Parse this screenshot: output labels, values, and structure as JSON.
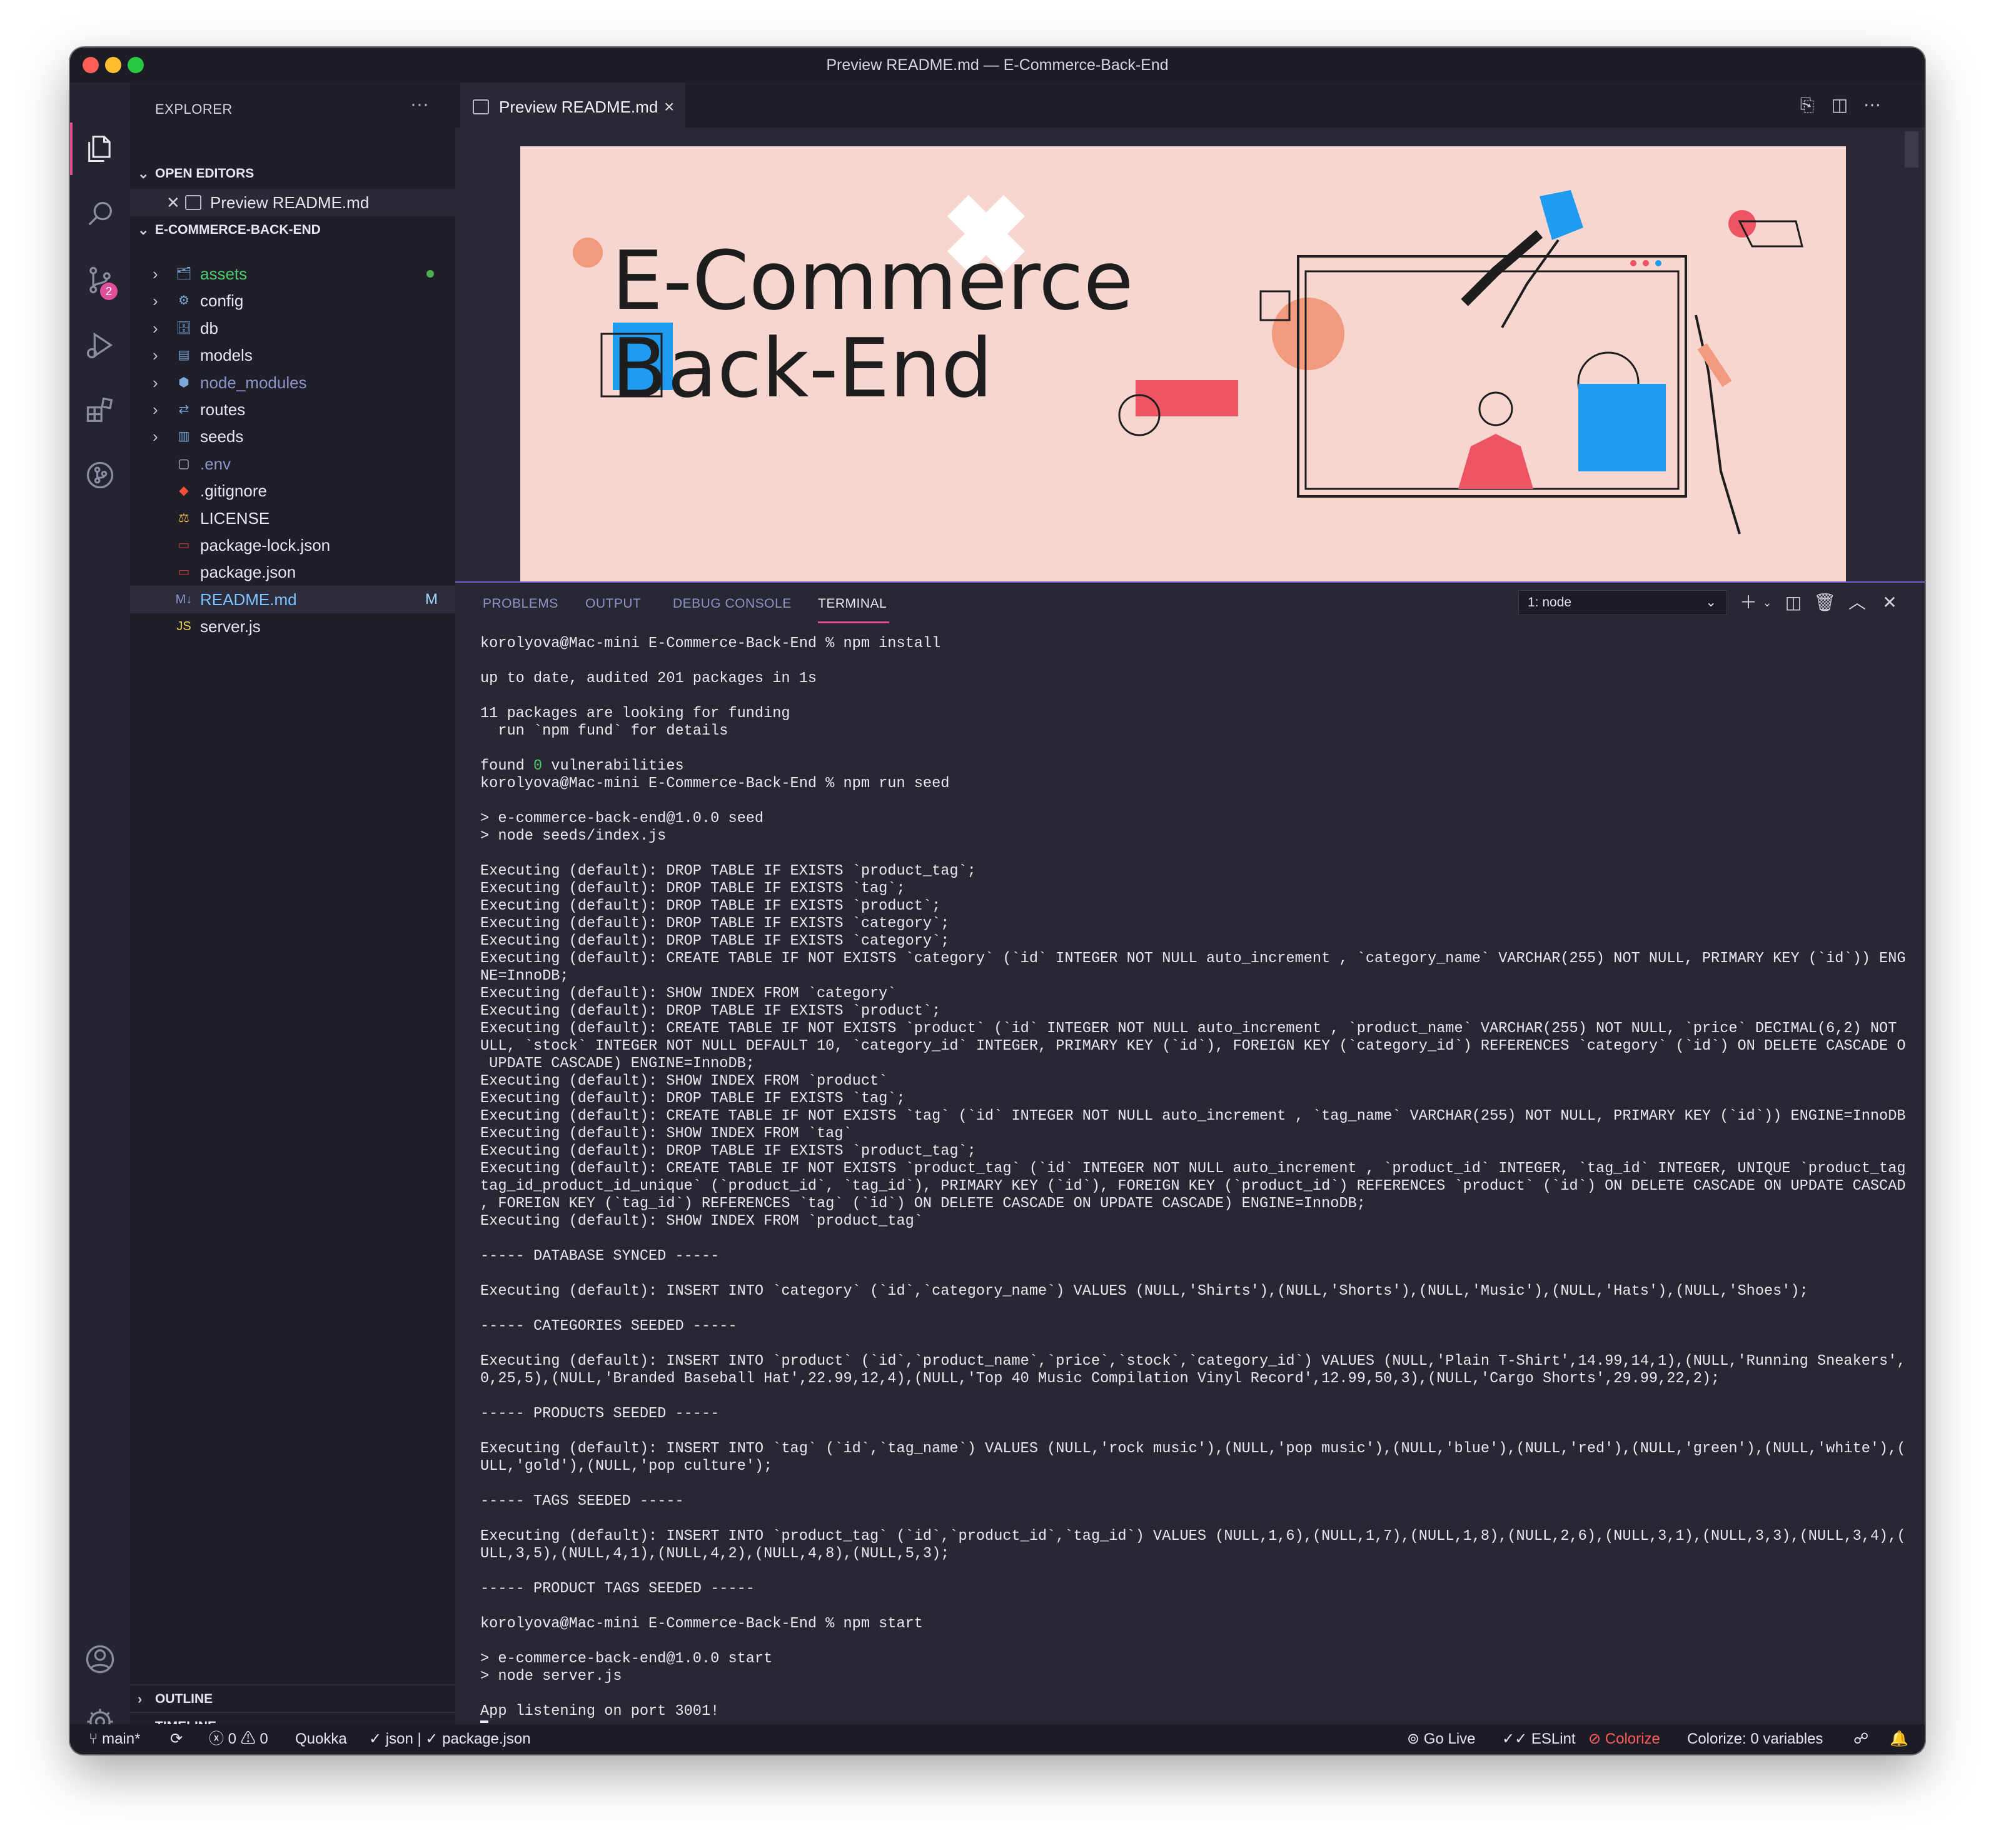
{
  "window": {
    "title": "Preview README.md — E-Commerce-Back-End"
  },
  "activity_bar": {
    "icons": [
      "files-icon",
      "search-icon",
      "source-control-icon",
      "run-debug-icon",
      "extensions-icon",
      "git-graph-icon",
      "account-icon",
      "settings-gear-icon"
    ],
    "source_control_badge": "2"
  },
  "sidebar": {
    "title": "EXPLORER",
    "more": "···",
    "open_editors_label": "OPEN EDITORS",
    "open_editor_item": "Preview README.md",
    "project_label": "E-COMMERCE-BACK-END",
    "tree": [
      {
        "label": "assets",
        "type": "folder",
        "color": "#4ec969"
      },
      {
        "label": "config",
        "type": "folder",
        "color": "#e6e6ec"
      },
      {
        "label": "db",
        "type": "folder",
        "color": "#e6e6ec"
      },
      {
        "label": "models",
        "type": "folder",
        "color": "#e6e6ec"
      },
      {
        "label": "node_modules",
        "type": "folder",
        "color": "#8c93c6"
      },
      {
        "label": "routes",
        "type": "folder",
        "color": "#e6e6ec"
      },
      {
        "label": "seeds",
        "type": "folder",
        "color": "#e6e6ec"
      },
      {
        "label": ".env",
        "type": "file",
        "color": "#8c93c6"
      },
      {
        "label": ".gitignore",
        "type": "file",
        "color": "#e6e6ec"
      },
      {
        "label": "LICENSE",
        "type": "file",
        "color": "#e6e6ec"
      },
      {
        "label": "package-lock.json",
        "type": "file",
        "color": "#e6e6ec"
      },
      {
        "label": "package.json",
        "type": "file",
        "color": "#e6e6ec"
      },
      {
        "label": "README.md",
        "type": "file",
        "color": "#7cc4ff",
        "git": "M"
      },
      {
        "label": "server.js",
        "type": "file",
        "color": "#e6e6ec"
      }
    ],
    "outline_label": "OUTLINE",
    "timeline_label": "TIMELINE"
  },
  "editor": {
    "tab_label": "Preview README.md",
    "banner": {
      "line1": "E-Commerce",
      "line2": "Back-End"
    }
  },
  "panel": {
    "tabs": [
      "PROBLEMS",
      "OUTPUT",
      "DEBUG CONSOLE",
      "TERMINAL"
    ],
    "active_tab": "TERMINAL",
    "terminal_select": "1: node",
    "terminal_lines": [
      "korolyova@Mac-mini E-Commerce-Back-End % npm install",
      "",
      "up to date, audited 201 packages in 1s",
      "",
      "11 packages are looking for funding",
      "  run `npm fund` for details",
      "",
      "found 0 vulnerabilities",
      "korolyova@Mac-mini E-Commerce-Back-End % npm run seed",
      "",
      "> e-commerce-back-end@1.0.0 seed",
      "> node seeds/index.js",
      "",
      "Executing (default): DROP TABLE IF EXISTS `product_tag`;",
      "Executing (default): DROP TABLE IF EXISTS `tag`;",
      "Executing (default): DROP TABLE IF EXISTS `product`;",
      "Executing (default): DROP TABLE IF EXISTS `category`;",
      "Executing (default): DROP TABLE IF EXISTS `category`;",
      "Executing (default): CREATE TABLE IF NOT EXISTS `category` (`id` INTEGER NOT NULL auto_increment , `category_name` VARCHAR(255) NOT NULL, PRIMARY KEY (`id`)) ENGI",
      "NE=InnoDB;",
      "Executing (default): SHOW INDEX FROM `category`",
      "Executing (default): DROP TABLE IF EXISTS `product`;",
      "Executing (default): CREATE TABLE IF NOT EXISTS `product` (`id` INTEGER NOT NULL auto_increment , `product_name` VARCHAR(255) NOT NULL, `price` DECIMAL(6,2) NOT N",
      "ULL, `stock` INTEGER NOT NULL DEFAULT 10, `category_id` INTEGER, PRIMARY KEY (`id`), FOREIGN KEY (`category_id`) REFERENCES `category` (`id`) ON DELETE CASCADE ON",
      " UPDATE CASCADE) ENGINE=InnoDB;",
      "Executing (default): SHOW INDEX FROM `product`",
      "Executing (default): DROP TABLE IF EXISTS `tag`;",
      "Executing (default): CREATE TABLE IF NOT EXISTS `tag` (`id` INTEGER NOT NULL auto_increment , `tag_name` VARCHAR(255) NOT NULL, PRIMARY KEY (`id`)) ENGINE=InnoDB;",
      "Executing (default): SHOW INDEX FROM `tag`",
      "Executing (default): DROP TABLE IF EXISTS `product_tag`;",
      "Executing (default): CREATE TABLE IF NOT EXISTS `product_tag` (`id` INTEGER NOT NULL auto_increment , `product_id` INTEGER, `tag_id` INTEGER, UNIQUE `product_tag_",
      "tag_id_product_id_unique` (`product_id`, `tag_id`), PRIMARY KEY (`id`), FOREIGN KEY (`product_id`) REFERENCES `product` (`id`) ON DELETE CASCADE ON UPDATE CASCADE",
      ", FOREIGN KEY (`tag_id`) REFERENCES `tag` (`id`) ON DELETE CASCADE ON UPDATE CASCADE) ENGINE=InnoDB;",
      "Executing (default): SHOW INDEX FROM `product_tag`",
      "",
      "----- DATABASE SYNCED -----",
      "",
      "Executing (default): INSERT INTO `category` (`id`,`category_name`) VALUES (NULL,'Shirts'),(NULL,'Shorts'),(NULL,'Music'),(NULL,'Hats'),(NULL,'Shoes');",
      "",
      "----- CATEGORIES SEEDED -----",
      "",
      "Executing (default): INSERT INTO `product` (`id`,`product_name`,`price`,`stock`,`category_id`) VALUES (NULL,'Plain T-Shirt',14.99,14,1),(NULL,'Running Sneakers',9",
      "0,25,5),(NULL,'Branded Baseball Hat',22.99,12,4),(NULL,'Top 40 Music Compilation Vinyl Record',12.99,50,3),(NULL,'Cargo Shorts',29.99,22,2);",
      "",
      "----- PRODUCTS SEEDED -----",
      "",
      "Executing (default): INSERT INTO `tag` (`id`,`tag_name`) VALUES (NULL,'rock music'),(NULL,'pop music'),(NULL,'blue'),(NULL,'red'),(NULL,'green'),(NULL,'white'),(N",
      "ULL,'gold'),(NULL,'pop culture');",
      "",
      "----- TAGS SEEDED -----",
      "",
      "Executing (default): INSERT INTO `product_tag` (`id`,`product_id`,`tag_id`) VALUES (NULL,1,6),(NULL,1,7),(NULL,1,8),(NULL,2,6),(NULL,3,1),(NULL,3,3),(NULL,3,4),(N",
      "ULL,3,5),(NULL,4,1),(NULL,4,2),(NULL,4,8),(NULL,5,3);",
      "",
      "----- PRODUCT TAGS SEEDED -----",
      "",
      "korolyova@Mac-mini E-Commerce-Back-End % npm start",
      "",
      "> e-commerce-back-end@1.0.0 start",
      "> node server.js",
      "",
      "App listening on port 3001!"
    ]
  },
  "statusbar": {
    "branch": "main*",
    "errors": "0",
    "warnings": "0",
    "quokka": "Quokka",
    "json_check": "✓ json | ✓ package.json",
    "go_live": "Go Live",
    "eslint": "ESLint",
    "colorize": "Colorize",
    "colorize_vars": "Colorize: 0 variables"
  }
}
